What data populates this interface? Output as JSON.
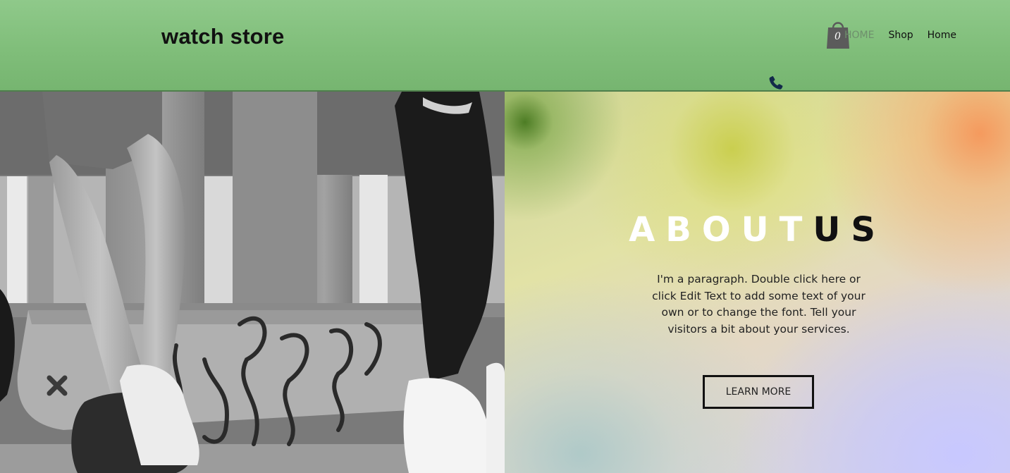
{
  "header": {
    "site_title": "watch store",
    "cart_count": "0",
    "nav": [
      {
        "label": "HOME"
      },
      {
        "label": "Shop"
      },
      {
        "label": "Home"
      }
    ]
  },
  "about": {
    "title_light": "ABOUT",
    "title_dark": "US",
    "paragraph": "I'm a paragraph. Double click here or click Edit Text to add some text of your own or to change the font. Tell your visitors a bit about your services.",
    "button_label": "LEARN MORE"
  },
  "colors": {
    "header_green": "#82c07c",
    "nav_active": "#6e8f6c",
    "phone_icon": "#132a4a"
  },
  "icons": [
    "shopping-bag-icon",
    "phone-icon",
    "close-icon"
  ]
}
